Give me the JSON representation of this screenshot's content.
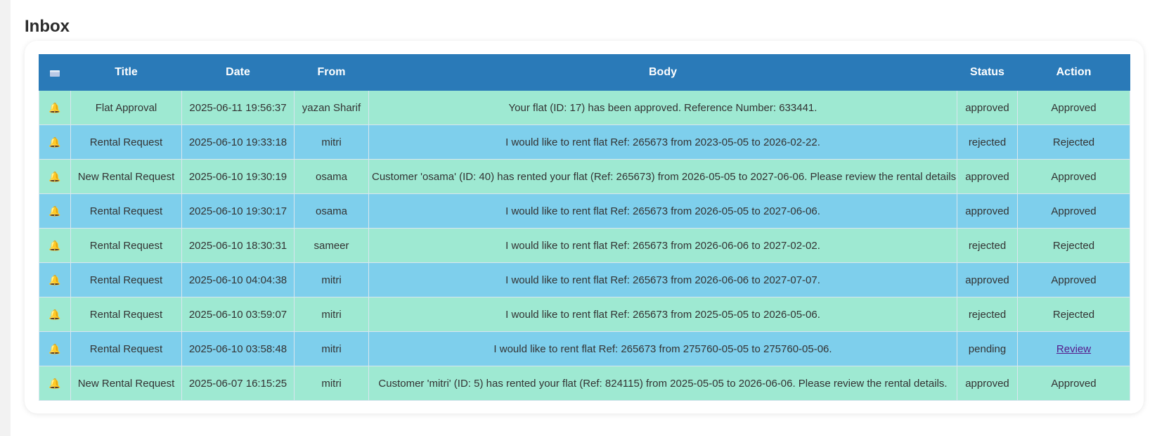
{
  "page": {
    "title": "Inbox"
  },
  "columns": {
    "icon": "header-mail-icon",
    "title": "Title",
    "date": "Date",
    "from": "From",
    "body": "Body",
    "status": "Status",
    "action": "Action"
  },
  "rows": [
    {
      "icon": "bell-icon",
      "title": "Flat Approval",
      "date": "2025-06-11 19:56:37",
      "from": "yazan Sharif",
      "body": "Your flat (ID: 17) has been approved. Reference Number: 633441.",
      "status": "approved",
      "action": "Approved"
    },
    {
      "icon": "bell-icon",
      "title": "Rental Request",
      "date": "2025-06-10 19:33:18",
      "from": "mitri",
      "body": "I would like to rent flat Ref: 265673 from 2023-05-05 to 2026-02-22.",
      "status": "rejected",
      "action": "Rejected"
    },
    {
      "icon": "bell-icon",
      "title": "New Rental Request",
      "date": "2025-06-10 19:30:19",
      "from": "osama",
      "body": "Customer 'osama' (ID: 40) has rented your flat (Ref: 265673) from 2026-05-05 to 2027-06-06. Please review the rental details.",
      "status": "approved",
      "action": "Approved"
    },
    {
      "icon": "bell-icon",
      "title": "Rental Request",
      "date": "2025-06-10 19:30:17",
      "from": "osama",
      "body": "I would like to rent flat Ref: 265673 from 2026-05-05 to 2027-06-06.",
      "status": "approved",
      "action": "Approved"
    },
    {
      "icon": "bell-icon",
      "title": "Rental Request",
      "date": "2025-06-10 18:30:31",
      "from": "sameer",
      "body": "I would like to rent flat Ref: 265673 from 2026-06-06 to 2027-02-02.",
      "status": "rejected",
      "action": "Rejected"
    },
    {
      "icon": "bell-icon",
      "title": "Rental Request",
      "date": "2025-06-10 04:04:38",
      "from": "mitri",
      "body": "I would like to rent flat Ref: 265673 from 2026-06-06 to 2027-07-07.",
      "status": "approved",
      "action": "Approved"
    },
    {
      "icon": "bell-icon",
      "title": "Rental Request",
      "date": "2025-06-10 03:59:07",
      "from": "mitri",
      "body": "I would like to rent flat Ref: 265673 from 2025-05-05 to 2026-05-06.",
      "status": "rejected",
      "action": "Rejected"
    },
    {
      "icon": "bell-icon",
      "title": "Rental Request",
      "date": "2025-06-10 03:58:48",
      "from": "mitri",
      "body": "I would like to rent flat Ref: 265673 from 275760-05-05 to 275760-05-06.",
      "status": "pending",
      "action": "Review"
    },
    {
      "icon": "bell-icon",
      "title": "New Rental Request",
      "date": "2025-06-07 16:15:25",
      "from": "mitri",
      "body": "Customer 'mitri' (ID: 5) has rented your flat (Ref: 824115) from 2025-05-05 to 2026-06-06. Please review the rental details.",
      "status": "approved",
      "action": "Approved"
    }
  ],
  "colors": {
    "header": "#2a7ab8",
    "row_green": "#9ee9d2",
    "row_blue": "#7ecfec"
  }
}
